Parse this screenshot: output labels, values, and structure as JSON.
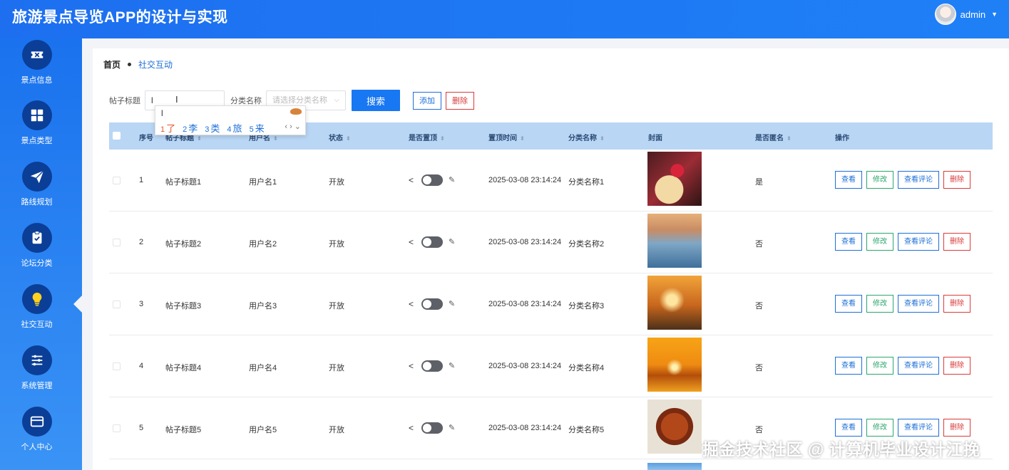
{
  "header": {
    "title": "旅游景点导览APP的设计与实现",
    "username": "admin"
  },
  "sidebar": {
    "items": [
      {
        "label": "景点信息",
        "icon": "ticket-icon"
      },
      {
        "label": "景点类型",
        "icon": "grid-icon"
      },
      {
        "label": "路线规划",
        "icon": "paper-plane-icon"
      },
      {
        "label": "论坛分类",
        "icon": "clipboard-check-icon"
      },
      {
        "label": "社交互动",
        "icon": "lightbulb-icon",
        "active": true
      },
      {
        "label": "系统管理",
        "icon": "sliders-icon"
      },
      {
        "label": "个人中心",
        "icon": "card-icon"
      }
    ]
  },
  "breadcrumb": {
    "home": "首页",
    "current": "社交互动"
  },
  "search": {
    "title_label": "帖子标题",
    "title_value": "l",
    "category_label": "分类名称",
    "category_placeholder": "请选择分类名称",
    "search_button": "搜索",
    "add_button": "添加",
    "delete_button": "删除"
  },
  "ime": {
    "composition": "l",
    "candidates": [
      {
        "num": "1",
        "char": "了"
      },
      {
        "num": "2",
        "char": "李"
      },
      {
        "num": "3",
        "char": "类"
      },
      {
        "num": "4",
        "char": "旅"
      },
      {
        "num": "5",
        "char": "来"
      }
    ]
  },
  "table": {
    "headers": {
      "index": "序号",
      "title": "帖子标题",
      "user": "用户名",
      "status": "状态",
      "pinned": "是否置顶",
      "pin_time": "置顶时间",
      "category": "分类名称",
      "cover": "封面",
      "anonymous": "是否匿名",
      "actions": "操作"
    },
    "rows": [
      {
        "index": "1",
        "title": "帖子标题1",
        "user": "用户名1",
        "status": "开放",
        "pin_time": "2025-03-08 23:14:24",
        "category": "分类名称1",
        "anonymous": "是",
        "cover": "dessert"
      },
      {
        "index": "2",
        "title": "帖子标题2",
        "user": "用户名2",
        "status": "开放",
        "pin_time": "2025-03-08 23:14:24",
        "category": "分类名称2",
        "anonymous": "否",
        "cover": "lake-sunset"
      },
      {
        "index": "3",
        "title": "帖子标题3",
        "user": "用户名3",
        "status": "开放",
        "pin_time": "2025-03-08 23:14:24",
        "category": "分类名称3",
        "anonymous": "否",
        "cover": "runner"
      },
      {
        "index": "4",
        "title": "帖子标题4",
        "user": "用户名4",
        "status": "开放",
        "pin_time": "2025-03-08 23:14:24",
        "category": "分类名称4",
        "anonymous": "否",
        "cover": "orange-sunset"
      },
      {
        "index": "5",
        "title": "帖子标题5",
        "user": "用户名5",
        "status": "开放",
        "pin_time": "2025-03-08 23:14:24",
        "category": "分类名称5",
        "anonymous": "否",
        "cover": "food-dish"
      }
    ],
    "actions": {
      "view": "查看",
      "edit": "修改",
      "comments": "查看评论",
      "delete": "删除"
    }
  },
  "watermark": "掘金技术社区 @ 计算机毕业设计江挽"
}
